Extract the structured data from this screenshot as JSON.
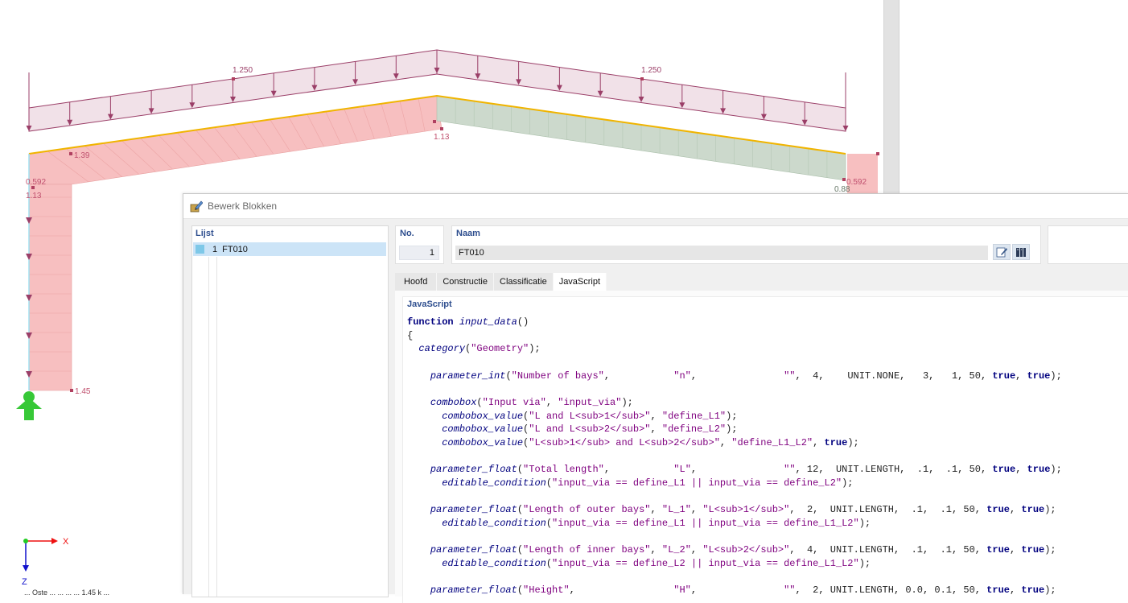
{
  "canvas": {
    "load_left": "1.250",
    "load_right": "1.250",
    "val_139": "1.39",
    "val_113_ridge": "1.13",
    "val_592_left": "0.592",
    "val_113_left": "1.13",
    "val_145": "1.45",
    "val_592_right": "0.592",
    "val_088": "0.88",
    "axis_x": "X",
    "axis_z": "Z",
    "status_text": "... Oste ... ... ... ... 1.45 k ..."
  },
  "dialog": {
    "title": "Bewerk Blokken",
    "list": {
      "header": "Lijst",
      "items": [
        {
          "no": "1",
          "name": "FT010"
        }
      ]
    },
    "no_label": "No.",
    "no_value": "1",
    "name_label": "Naam",
    "name_value": "FT010",
    "tabs": [
      "Hoofd",
      "Constructie",
      "Classificatie",
      "JavaScript"
    ],
    "active_tab": "JavaScript",
    "code_header": "JavaScript",
    "code_lines": [
      "function input_data()",
      "{",
      "  category(\"Geometry\");",
      "",
      "    parameter_int(\"Number of bays\",           \"n\",               \"\",  4,    UNIT.NONE,   3,   1, 50, true, true);",
      "",
      "    combobox(\"Input via\", \"input_via\");",
      "      combobox_value(\"L and L<sub>1</sub>\", \"define_L1\");",
      "      combobox_value(\"L and L<sub>2</sub>\", \"define_L2\");",
      "      combobox_value(\"L<sub>1</sub> and L<sub>2</sub>\", \"define_L1_L2\", true);",
      "",
      "    parameter_float(\"Total length\",           \"L\",               \"\", 12,  UNIT.LENGTH,  .1,  .1, 50, true, true);",
      "      editable_condition(\"input_via == define_L1 || input_via == define_L2\");",
      "",
      "    parameter_float(\"Length of outer bays\", \"L_1\", \"L<sub>1</sub>\",  2,  UNIT.LENGTH,  .1,  .1, 50, true, true);",
      "      editable_condition(\"input_via == define_L1 || input_via == define_L1_L2\");",
      "",
      "    parameter_float(\"Length of inner bays\", \"L_2\", \"L<sub>2</sub>\",  4,  UNIT.LENGTH,  .1,  .1, 50, true, true);",
      "      editable_condition(\"input_via == define_L2 || input_via == define_L1_L2\");",
      "",
      "    parameter_float(\"Height\",                 \"H\",               \"\",  2, UNIT.LENGTH, 0.0, 0.1, 50, true, true);"
    ]
  },
  "colors": {
    "load_line": "#9b3f68",
    "load_fill": "#f1e1e8",
    "beam_edge": "#f0b400",
    "result_red": "#f7bfc0",
    "result_green": "#ccd9cc",
    "support_green": "#37c837",
    "tab_active": "#ffffff",
    "list_selected": "#cce4f7",
    "code_keyword": "#00007f",
    "code_string": "#7f007f"
  },
  "icons": [
    "dialog-edit-icon",
    "edit-script-icon",
    "library-icon",
    "support-icon"
  ]
}
